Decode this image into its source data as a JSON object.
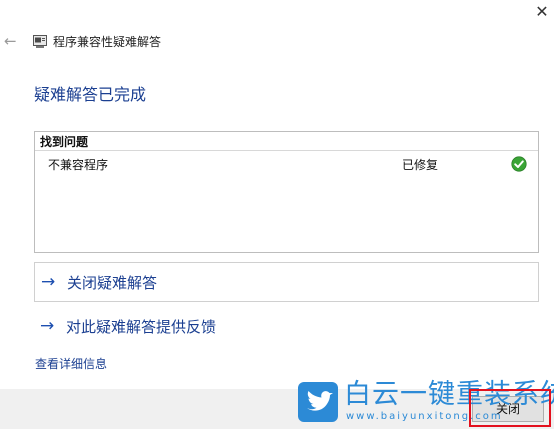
{
  "window": {
    "close_glyph": "✕",
    "back_glyph": "←",
    "app_title": "程序兼容性疑难解答",
    "app_icon": "troubleshooter-icon"
  },
  "heading": "疑难解答已完成",
  "results": {
    "header": "找到问题",
    "rows": [
      {
        "name": "不兼容程序",
        "status": "已修复",
        "status_icon": "check-circle-icon",
        "status_color": "#3aa536"
      }
    ]
  },
  "commands": [
    {
      "arrow": "→",
      "label": "关闭疑难解答"
    },
    {
      "arrow": "→",
      "label": "对此疑难解答提供反馈"
    }
  ],
  "details_link": "查看详细信息",
  "footer": {
    "close_button": "关闭"
  },
  "watermark": {
    "title": "白云一键重装系统",
    "url": "www.baiyunxitong.com",
    "color": "#2c8ad6"
  },
  "colors": {
    "link": "#1b3f91",
    "highlight": "#e3101e"
  }
}
